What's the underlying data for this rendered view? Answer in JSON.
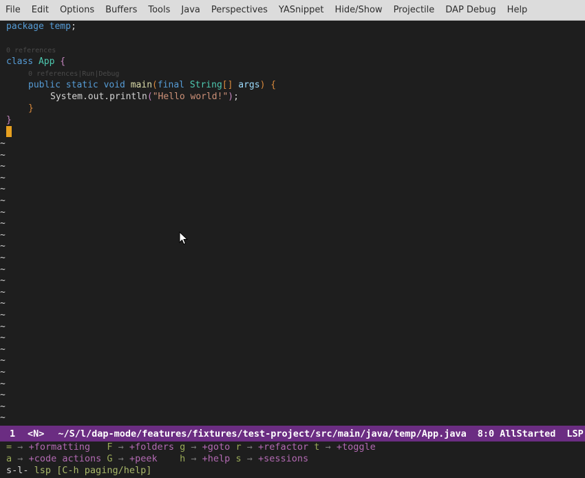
{
  "menubar": {
    "items": [
      "File",
      "Edit",
      "Options",
      "Buffers",
      "Tools",
      "Java",
      "Perspectives",
      "YASnippet",
      "Hide/Show",
      "Projectile",
      "DAP Debug",
      "Help"
    ]
  },
  "editor": {
    "code": {
      "l1_kw": "package",
      "l1_name": "temp",
      "l1_semi": ";",
      "lens_refs_class": "0 references",
      "l4_kw": "class",
      "l4_name": "App",
      "l4_brace": "{",
      "lens_method": "0 references|Run|Debug",
      "l6_mods": "public static void",
      "l6_fn": "main",
      "l6_paren_open": "(",
      "l6_final": "final",
      "l6_type": "String",
      "l6_brackets": "[]",
      "l6_arg": "args",
      "l6_paren_close": ")",
      "l6_brace": "{",
      "l7_call": "System.out.println",
      "l7_paren_open": "(",
      "l7_str": "\"Hello world!\"",
      "l7_paren_close": ")",
      "l7_semi": ";",
      "l8_brace": "}",
      "l9_brace": "}"
    },
    "fringe_char": "~"
  },
  "modeline": {
    "window_number": "1",
    "evil_state": "<N>",
    "file_path": "~/S/l/dap-mode/features/fixtures/test-project/src/main/java/temp/App.java",
    "position": "8:0",
    "status": "AllStarted",
    "lsp": "LSP"
  },
  "which_key": {
    "row1": [
      {
        "key": "=",
        "arrow": "→",
        "desc": "+formatting"
      },
      {
        "key": "F",
        "arrow": "→",
        "desc": "+folders"
      },
      {
        "key": "g",
        "arrow": "→",
        "desc": "+goto"
      },
      {
        "key": "r",
        "arrow": "→",
        "desc": "+refactor"
      },
      {
        "key": "t",
        "arrow": "→",
        "desc": "+toggle"
      }
    ],
    "row2": [
      {
        "key": "a",
        "arrow": "→",
        "desc": "+code actions"
      },
      {
        "key": "G",
        "arrow": "→",
        "desc": "+peek"
      },
      {
        "key": "h",
        "arrow": "→",
        "desc": "+help"
      },
      {
        "key": "s",
        "arrow": "→",
        "desc": "+sessions"
      }
    ],
    "prefix": "s-l-",
    "mode_hint": "lsp [C-h paging/help]"
  },
  "colors": {
    "modeline_bg": "#6b2d82",
    "cursor": "#e6a020",
    "editor_bg": "#1e1e1e"
  }
}
